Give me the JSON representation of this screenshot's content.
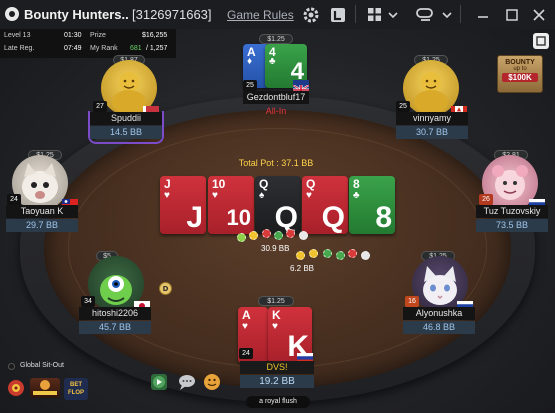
{
  "window": {
    "title": "Bounty Hunters..",
    "table_id": "[3126971663]",
    "rules_link": "Game Rules"
  },
  "info": {
    "level_label": "Level 13",
    "level_time": "01:30",
    "prize_label": "Prize",
    "prize_value": "$16,255",
    "late_reg_label": "Late Reg.",
    "late_reg_time": "07:49",
    "rank_label": "My Rank",
    "rank_value": "681",
    "rank_total": "/ 1,257"
  },
  "bounty_badge": {
    "line1": "BOUNTY",
    "line2": "up to",
    "line3": "$100K"
  },
  "pot": {
    "label": "Total Pot : 37.1 BB"
  },
  "board": [
    {
      "rank": "J",
      "suit": "♥",
      "suit_name": "hearts"
    },
    {
      "rank": "10",
      "suit": "♥",
      "suit_name": "hearts"
    },
    {
      "rank": "Q",
      "suit": "♠",
      "suit_name": "spades"
    },
    {
      "rank": "Q",
      "suit": "♥",
      "suit_name": "hearts"
    },
    {
      "rank": "8",
      "suit": "♣",
      "suit_name": "clubs"
    }
  ],
  "chips": {
    "main_amount": "30.9 BB",
    "side_amount": "6.2 BB"
  },
  "players": {
    "top": {
      "name": "Gezdontbluf17",
      "status": "All-In",
      "bounty": "$1.25",
      "level": "25",
      "cards": [
        "A",
        "4"
      ]
    },
    "top_left": {
      "name": "Spuddii",
      "stack": "14.5 BB",
      "bounty": "$1.87",
      "level": "27"
    },
    "top_right": {
      "name": "vinnyamy",
      "stack": "30.7 BB",
      "bounty": "$1.25",
      "level": "25"
    },
    "mid_left": {
      "name": "Taoyuan K",
      "stack": "29.7 BB",
      "bounty": "$1.25",
      "level": "24"
    },
    "mid_right": {
      "name": "Tuz Tuzovskiy",
      "stack": "73.5 BB",
      "bounty": "$2.81",
      "level": "26"
    },
    "bot_left": {
      "name": "hitoshi2206",
      "stack": "45.7 BB",
      "bounty": "$5",
      "level": "34"
    },
    "bot_right": {
      "name": "Alyonushka",
      "stack": "46.8 BB",
      "bounty": "$1.25",
      "level": "16"
    },
    "hero": {
      "name": "DVS!",
      "stack": "19.2 BB",
      "bounty": "$1.25",
      "level": "24",
      "cards": [
        "A",
        "K"
      ],
      "hand_label": "a royal flush"
    }
  },
  "bottom": {
    "sitout_label": "Global Sit-Out",
    "logo_3": "BET FLOP"
  },
  "colors": {
    "accent_red": "#e2353f",
    "stack_blue": "#9fc5ea",
    "pot_yellow": "#ffd34d"
  }
}
